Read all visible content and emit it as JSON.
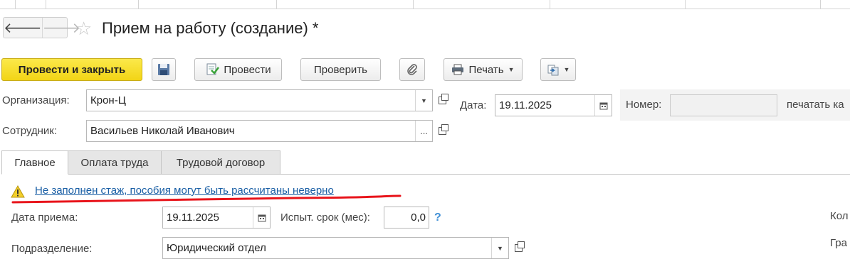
{
  "window": {
    "title": "Прием на работу (создание) *"
  },
  "toolbar": {
    "post_and_close": "Провести и закрыть",
    "post": "Провести",
    "check": "Проверить",
    "print": "Печать"
  },
  "header": {
    "organization_label": "Организация:",
    "organization_value": "Крон-Ц",
    "date_label": "Дата:",
    "date_value": "19.11.2025",
    "number_label": "Номер:",
    "number_value": "",
    "print_as_label": "печатать ка",
    "employee_label": "Сотрудник:",
    "employee_value": "Васильев Николай Иванович"
  },
  "tabs": [
    "Главное",
    "Оплата труда",
    "Трудовой договор"
  ],
  "main": {
    "warning_text": "Не заполнен стаж, пособия могут быть рассчитаны неверно",
    "hire_date_label": "Дата приема:",
    "hire_date_value": "19.11.2025",
    "probation_label": "Испыт. срок (мес):",
    "probation_value": "0,0",
    "help_mark": "?",
    "department_label": "Подразделение:",
    "department_value": "Юридический отдел",
    "right_label_1": "Кол",
    "right_label_2": "Гра"
  },
  "colors": {
    "primary_button": "#f5dc1f",
    "link": "#1a5fa5",
    "underline_annotation": "#e8141b"
  },
  "icons": [
    "arrow-left-icon",
    "arrow-right-icon",
    "star-icon",
    "floppy-disk-icon",
    "post-document-icon",
    "paperclip-icon",
    "printer-icon",
    "exchange-icon",
    "dropdown-arrow-icon",
    "open-form-icon",
    "calendar-icon",
    "warning-icon"
  ]
}
